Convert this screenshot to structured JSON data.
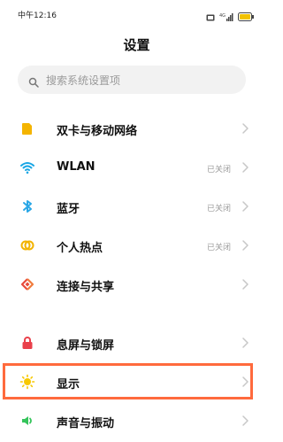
{
  "status_bar": {
    "time": "中午12:16",
    "battery_label": "4G",
    "signal_label": "4G"
  },
  "page": {
    "title": "设置"
  },
  "search": {
    "placeholder": "搜索系统设置项"
  },
  "settings": {
    "group1": [
      {
        "label": "双卡与移动网络",
        "status": "",
        "icon": "sim-card-icon",
        "color": "#f4b400"
      },
      {
        "label": "WLAN",
        "status": "已关闭",
        "icon": "wifi-icon",
        "color": "#18a6e5"
      },
      {
        "label": "蓝牙",
        "status": "已关闭",
        "icon": "bluetooth-icon",
        "color": "#2aa7e6"
      },
      {
        "label": "个人热点",
        "status": "已关闭",
        "icon": "hotspot-icon",
        "color": "#f2b300"
      },
      {
        "label": "连接与共享",
        "status": "",
        "icon": "connection-sharing-icon",
        "color": "#e84a3b"
      }
    ],
    "group2": [
      {
        "label": "息屏与锁屏",
        "status": "",
        "icon": "lock-icon",
        "color": "#e9414b"
      },
      {
        "label": "显示",
        "status": "",
        "icon": "sun-icon",
        "color": "#f7c800"
      },
      {
        "label": "声音与振动",
        "status": "",
        "icon": "speaker-icon",
        "color": "#35c45b"
      }
    ]
  },
  "highlight": {
    "color": "#ff6a3d",
    "target": "显示"
  }
}
